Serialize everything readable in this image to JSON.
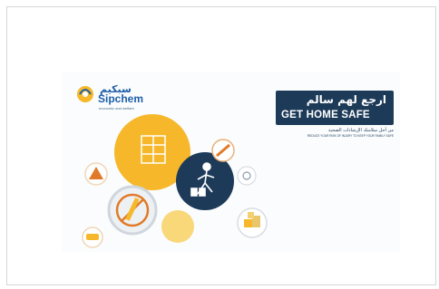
{
  "poster": {
    "logo": {
      "arabic": "سبكيم",
      "english": "Sipchem",
      "tagline": "economic and welfare"
    },
    "banner": {
      "arabic_title": "ارجع لهم سالم",
      "english_title": "GET HOME SAFE"
    },
    "subtitle_arabic": "من أجل سلامتك الإرشادات الصحية",
    "subtitle_english": "REDUCE YOUR RISK OF INJURY TO KEEP YOUR FAMILY SAFE"
  },
  "colors": {
    "navy": "#1d3b58",
    "yellow": "#f6b82a",
    "blue": "#1f5fa8",
    "orange": "#e07a2a"
  }
}
